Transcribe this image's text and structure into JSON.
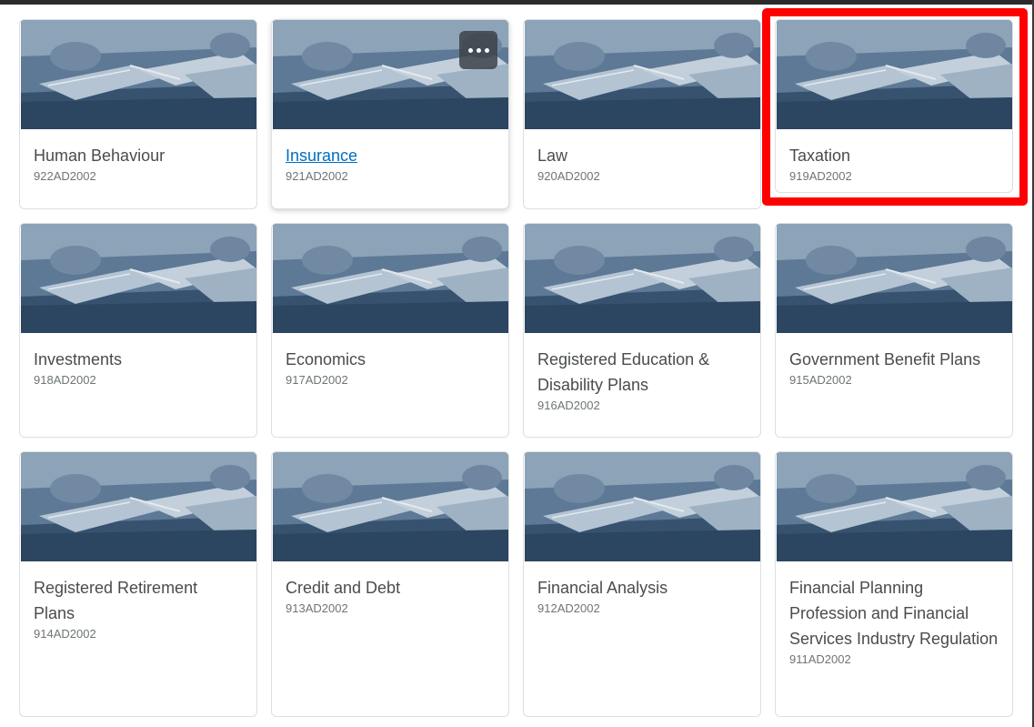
{
  "courses": [
    {
      "title": "Human Behaviour",
      "code": "922AD2002"
    },
    {
      "title": "Insurance",
      "code": "921AD2002"
    },
    {
      "title": "Law",
      "code": "920AD2002"
    },
    {
      "title": "Taxation",
      "code": "919AD2002"
    },
    {
      "title": "Investments",
      "code": "918AD2002"
    },
    {
      "title": "Economics",
      "code": "917AD2002"
    },
    {
      "title": "Registered Education & Disability Plans",
      "code": "916AD2002"
    },
    {
      "title": "Government Benefit Plans",
      "code": "915AD2002"
    },
    {
      "title": "Registered Retirement Plans",
      "code": "914AD2002"
    },
    {
      "title": "Credit and Debt",
      "code": "913AD2002"
    },
    {
      "title": "Financial Analysis",
      "code": "912AD2002"
    },
    {
      "title": "Financial Planning Profession and Financial Services Industry Regulation",
      "code": "911AD2002"
    }
  ],
  "card_menu": {
    "icon": "more-options-icon"
  },
  "colors": {
    "link": "#006fbf",
    "highlight": "#ff0000",
    "image_tint": "#4f6f8f"
  }
}
